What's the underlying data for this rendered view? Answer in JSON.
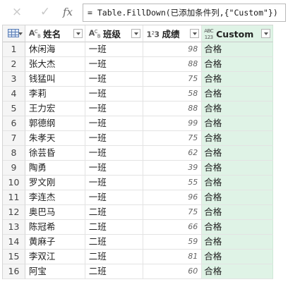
{
  "formula_bar": {
    "cancel_icon": "×",
    "confirm_icon": "✓",
    "fx_label": "fx",
    "formula": "= Table.FillDown(已添加条件列,{\"Custom\"})"
  },
  "columns": [
    {
      "type_top": "A",
      "type_bottom": "B",
      "type_sub": "C",
      "title": "姓名"
    },
    {
      "type_top": "A",
      "type_bottom": "B",
      "type_sub": "C",
      "title": "班级"
    },
    {
      "type_top": "1",
      "type_bottom": "2",
      "type_sub": "3",
      "title": "成绩"
    },
    {
      "type_top": "ABC",
      "type_bottom": "123",
      "type_sub": "",
      "title": "Custom"
    }
  ],
  "rows": [
    {
      "n": "1",
      "name": "休闲海",
      "cls": "一班",
      "score": "98",
      "custom": "合格"
    },
    {
      "n": "2",
      "name": "张大杰",
      "cls": "一班",
      "score": "88",
      "custom": "合格"
    },
    {
      "n": "3",
      "name": "钱猛叫",
      "cls": "一班",
      "score": "75",
      "custom": "合格"
    },
    {
      "n": "4",
      "name": "李莉",
      "cls": "一班",
      "score": "58",
      "custom": "合格"
    },
    {
      "n": "5",
      "name": "王力宏",
      "cls": "一班",
      "score": "88",
      "custom": "合格"
    },
    {
      "n": "6",
      "name": "郭德纲",
      "cls": "一班",
      "score": "99",
      "custom": "合格"
    },
    {
      "n": "7",
      "name": "朱孝天",
      "cls": "一班",
      "score": "75",
      "custom": "合格"
    },
    {
      "n": "8",
      "name": "徐芸昏",
      "cls": "一班",
      "score": "62",
      "custom": "合格"
    },
    {
      "n": "9",
      "name": "陶勇",
      "cls": "一班",
      "score": "39",
      "custom": "合格"
    },
    {
      "n": "10",
      "name": "罗文刚",
      "cls": "一班",
      "score": "55",
      "custom": "合格"
    },
    {
      "n": "11",
      "name": "李连杰",
      "cls": "一班",
      "score": "96",
      "custom": "合格"
    },
    {
      "n": "12",
      "name": "奥巴马",
      "cls": "二班",
      "score": "75",
      "custom": "合格"
    },
    {
      "n": "13",
      "name": "陈冠希",
      "cls": "二班",
      "score": "66",
      "custom": "合格"
    },
    {
      "n": "14",
      "name": "黄麻子",
      "cls": "二班",
      "score": "59",
      "custom": "合格"
    },
    {
      "n": "15",
      "name": "李双江",
      "cls": "二班",
      "score": "81",
      "custom": "合格"
    },
    {
      "n": "16",
      "name": "阿宝",
      "cls": "二班",
      "score": "60",
      "custom": "合格"
    }
  ],
  "colors": {
    "custom_column_bg": "#dff3e6",
    "row_header_bg": "#f5f5f5"
  }
}
